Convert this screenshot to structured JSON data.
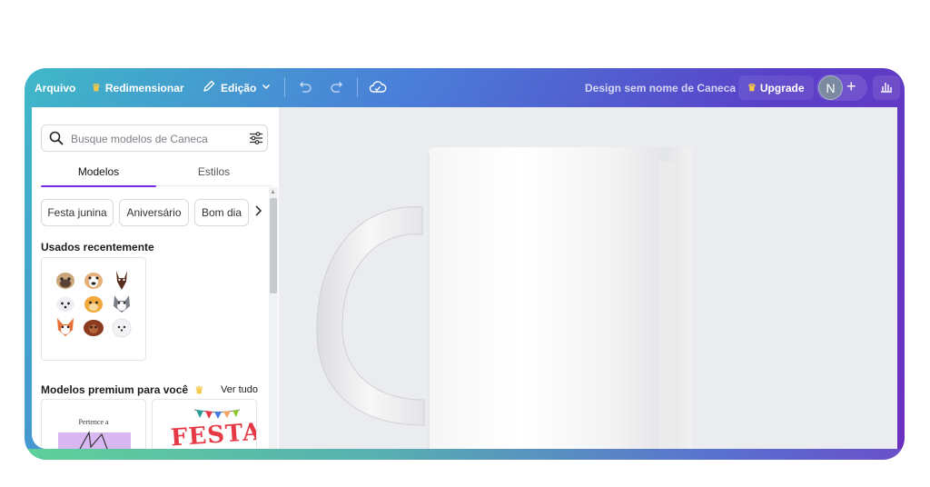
{
  "topbar": {
    "file_label": "Arquivo",
    "resize_label": "Redimensionar",
    "edit_label": "Edição",
    "doc_title": "Design sem nome de Caneca",
    "upgrade_label": "Upgrade",
    "avatar_initial": "N",
    "add_label": "+"
  },
  "panel": {
    "search_placeholder": "Busque modelos de Caneca",
    "tabs": [
      {
        "label": "Modelos",
        "active": true
      },
      {
        "label": "Estilos",
        "active": false
      }
    ],
    "chips": [
      "Festa junina",
      "Aniversário",
      "Bom dia"
    ],
    "recent_title": "Usados recentemente",
    "premium_title": "Modelos premium para você",
    "see_all": "Ver tudo",
    "premium_thumb_1_text": "Pertence a",
    "premium_thumb_2_text": "FESTA"
  },
  "colors": {
    "accent": "#7d2ae8",
    "crown": "#f7c948"
  }
}
